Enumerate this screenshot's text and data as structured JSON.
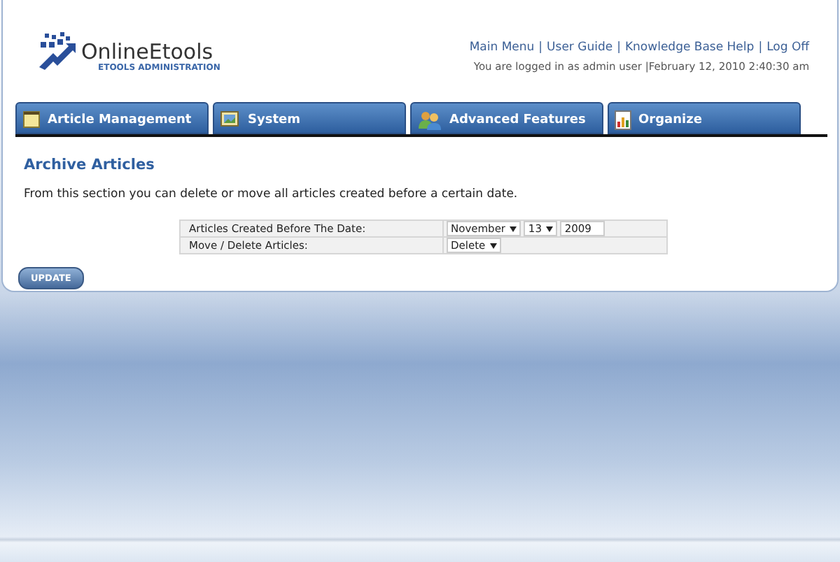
{
  "logo": {
    "name": "OnlineEtools",
    "subtitle": "ETOOLS ADMINISTRATION"
  },
  "header": {
    "links": [
      "Main Menu",
      "User Guide",
      "Knowledge Base Help",
      "Log Off"
    ],
    "separator": "|",
    "status": "You are logged in as admin user |February 12, 2010 2:40:30 am"
  },
  "tabs": [
    {
      "label": "Article Management",
      "kind": "folder",
      "selected": false
    },
    {
      "label": "System",
      "kind": "photo",
      "selected": false
    },
    {
      "label": "Advanced Features",
      "kind": "users",
      "selected": false
    },
    {
      "label": "Organize",
      "kind": "chart",
      "selected": false
    }
  ],
  "section": {
    "title": "Archive Articles",
    "description": "From this section you can delete or move all articles created before a certain date."
  },
  "form": {
    "rows": [
      {
        "label": "Articles Created Before The Date:",
        "kind": "date",
        "month": "November",
        "day": "13",
        "year": "2009"
      },
      {
        "label": "Move / Delete Articles:",
        "kind": "action",
        "value": "Delete"
      }
    ]
  },
  "buttons": [
    "UPDATE"
  ]
}
